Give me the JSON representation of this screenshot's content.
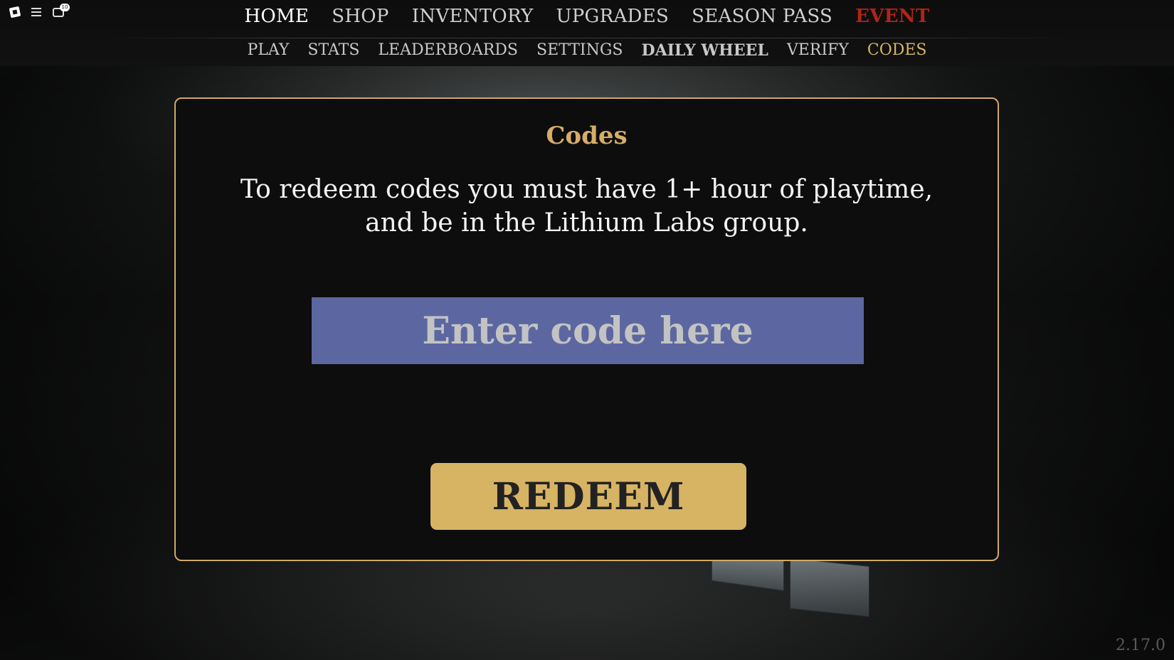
{
  "top_nav": {
    "items": [
      {
        "label": "HOME",
        "state": "active"
      },
      {
        "label": "SHOP",
        "state": "normal"
      },
      {
        "label": "INVENTORY",
        "state": "normal"
      },
      {
        "label": "UPGRADES",
        "state": "normal"
      },
      {
        "label": "SEASON PASS",
        "state": "normal"
      },
      {
        "label": "EVENT",
        "state": "highlight",
        "color": "#b02416"
      }
    ]
  },
  "sub_nav": {
    "items": [
      {
        "label": "PLAY"
      },
      {
        "label": "STATS"
      },
      {
        "label": "LEADERBOARDS"
      },
      {
        "label": "SETTINGS"
      },
      {
        "label": "DAILY WHEEL"
      },
      {
        "label": "VERIFY"
      },
      {
        "label": "CODES",
        "active": true
      }
    ]
  },
  "roblox_bar": {
    "icons": [
      "roblox-logo-icon",
      "menu-icon",
      "chat-icon"
    ],
    "chat_badge": "10"
  },
  "codes_panel": {
    "title": "Codes",
    "description_line1": "To redeem codes you must have 1+ hour of playtime,",
    "description_line2": "and be in the Lithium Labs group.",
    "input": {
      "placeholder": "Enter code here",
      "value": ""
    },
    "redeem_label": "REDEEM"
  },
  "version": "2.17.0",
  "colors": {
    "accent_gold": "#d6b464",
    "input_bg": "#5c67a1",
    "event_red": "#b02416",
    "active_sub_nav": "#d7b466"
  }
}
